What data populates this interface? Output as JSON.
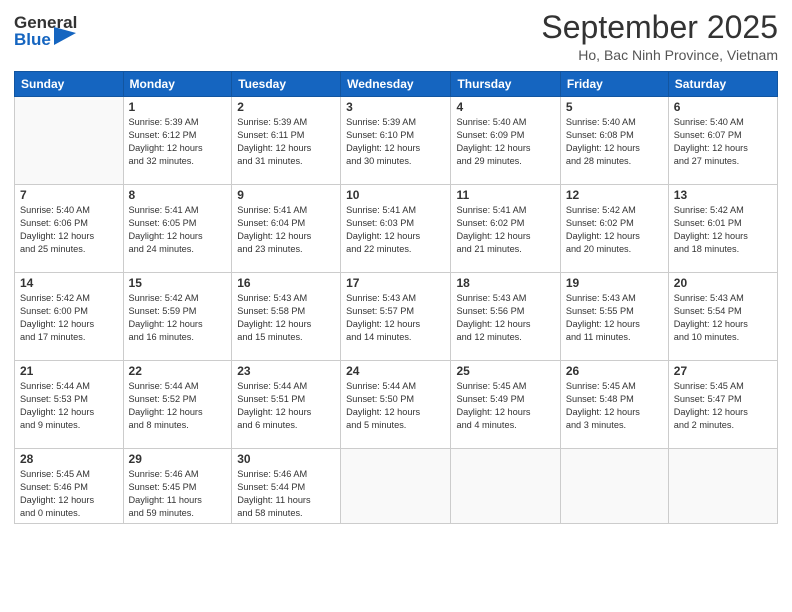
{
  "header": {
    "logo_text_general": "General",
    "logo_text_blue": "Blue",
    "month_title": "September 2025",
    "location": "Ho, Bac Ninh Province, Vietnam"
  },
  "weekdays": [
    "Sunday",
    "Monday",
    "Tuesday",
    "Wednesday",
    "Thursday",
    "Friday",
    "Saturday"
  ],
  "weeks": [
    [
      {
        "day": "",
        "info": ""
      },
      {
        "day": "1",
        "info": "Sunrise: 5:39 AM\nSunset: 6:12 PM\nDaylight: 12 hours\nand 32 minutes."
      },
      {
        "day": "2",
        "info": "Sunrise: 5:39 AM\nSunset: 6:11 PM\nDaylight: 12 hours\nand 31 minutes."
      },
      {
        "day": "3",
        "info": "Sunrise: 5:39 AM\nSunset: 6:10 PM\nDaylight: 12 hours\nand 30 minutes."
      },
      {
        "day": "4",
        "info": "Sunrise: 5:40 AM\nSunset: 6:09 PM\nDaylight: 12 hours\nand 29 minutes."
      },
      {
        "day": "5",
        "info": "Sunrise: 5:40 AM\nSunset: 6:08 PM\nDaylight: 12 hours\nand 28 minutes."
      },
      {
        "day": "6",
        "info": "Sunrise: 5:40 AM\nSunset: 6:07 PM\nDaylight: 12 hours\nand 27 minutes."
      }
    ],
    [
      {
        "day": "7",
        "info": "Sunrise: 5:40 AM\nSunset: 6:06 PM\nDaylight: 12 hours\nand 25 minutes."
      },
      {
        "day": "8",
        "info": "Sunrise: 5:41 AM\nSunset: 6:05 PM\nDaylight: 12 hours\nand 24 minutes."
      },
      {
        "day": "9",
        "info": "Sunrise: 5:41 AM\nSunset: 6:04 PM\nDaylight: 12 hours\nand 23 minutes."
      },
      {
        "day": "10",
        "info": "Sunrise: 5:41 AM\nSunset: 6:03 PM\nDaylight: 12 hours\nand 22 minutes."
      },
      {
        "day": "11",
        "info": "Sunrise: 5:41 AM\nSunset: 6:02 PM\nDaylight: 12 hours\nand 21 minutes."
      },
      {
        "day": "12",
        "info": "Sunrise: 5:42 AM\nSunset: 6:02 PM\nDaylight: 12 hours\nand 20 minutes."
      },
      {
        "day": "13",
        "info": "Sunrise: 5:42 AM\nSunset: 6:01 PM\nDaylight: 12 hours\nand 18 minutes."
      }
    ],
    [
      {
        "day": "14",
        "info": "Sunrise: 5:42 AM\nSunset: 6:00 PM\nDaylight: 12 hours\nand 17 minutes."
      },
      {
        "day": "15",
        "info": "Sunrise: 5:42 AM\nSunset: 5:59 PM\nDaylight: 12 hours\nand 16 minutes."
      },
      {
        "day": "16",
        "info": "Sunrise: 5:43 AM\nSunset: 5:58 PM\nDaylight: 12 hours\nand 15 minutes."
      },
      {
        "day": "17",
        "info": "Sunrise: 5:43 AM\nSunset: 5:57 PM\nDaylight: 12 hours\nand 14 minutes."
      },
      {
        "day": "18",
        "info": "Sunrise: 5:43 AM\nSunset: 5:56 PM\nDaylight: 12 hours\nand 12 minutes."
      },
      {
        "day": "19",
        "info": "Sunrise: 5:43 AM\nSunset: 5:55 PM\nDaylight: 12 hours\nand 11 minutes."
      },
      {
        "day": "20",
        "info": "Sunrise: 5:43 AM\nSunset: 5:54 PM\nDaylight: 12 hours\nand 10 minutes."
      }
    ],
    [
      {
        "day": "21",
        "info": "Sunrise: 5:44 AM\nSunset: 5:53 PM\nDaylight: 12 hours\nand 9 minutes."
      },
      {
        "day": "22",
        "info": "Sunrise: 5:44 AM\nSunset: 5:52 PM\nDaylight: 12 hours\nand 8 minutes."
      },
      {
        "day": "23",
        "info": "Sunrise: 5:44 AM\nSunset: 5:51 PM\nDaylight: 12 hours\nand 6 minutes."
      },
      {
        "day": "24",
        "info": "Sunrise: 5:44 AM\nSunset: 5:50 PM\nDaylight: 12 hours\nand 5 minutes."
      },
      {
        "day": "25",
        "info": "Sunrise: 5:45 AM\nSunset: 5:49 PM\nDaylight: 12 hours\nand 4 minutes."
      },
      {
        "day": "26",
        "info": "Sunrise: 5:45 AM\nSunset: 5:48 PM\nDaylight: 12 hours\nand 3 minutes."
      },
      {
        "day": "27",
        "info": "Sunrise: 5:45 AM\nSunset: 5:47 PM\nDaylight: 12 hours\nand 2 minutes."
      }
    ],
    [
      {
        "day": "28",
        "info": "Sunrise: 5:45 AM\nSunset: 5:46 PM\nDaylight: 12 hours\nand 0 minutes."
      },
      {
        "day": "29",
        "info": "Sunrise: 5:46 AM\nSunset: 5:45 PM\nDaylight: 11 hours\nand 59 minutes."
      },
      {
        "day": "30",
        "info": "Sunrise: 5:46 AM\nSunset: 5:44 PM\nDaylight: 11 hours\nand 58 minutes."
      },
      {
        "day": "",
        "info": ""
      },
      {
        "day": "",
        "info": ""
      },
      {
        "day": "",
        "info": ""
      },
      {
        "day": "",
        "info": ""
      }
    ]
  ]
}
